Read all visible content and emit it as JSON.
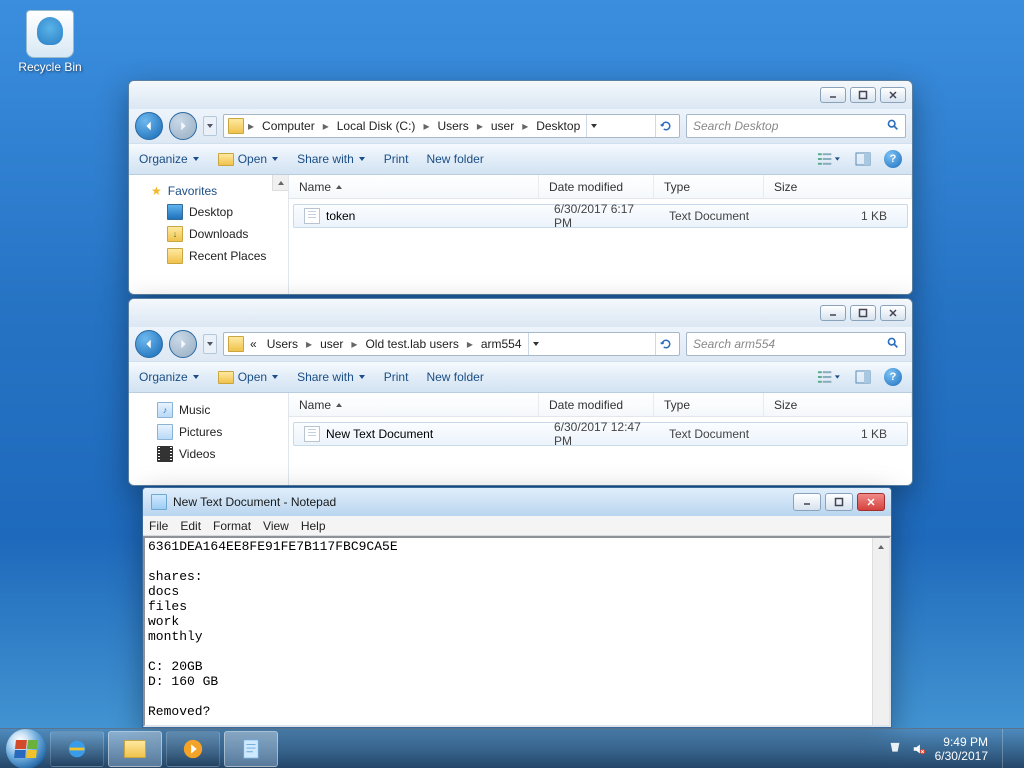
{
  "desktop": {
    "recycle_bin": "Recycle Bin"
  },
  "explorer1": {
    "crumbs": [
      "Computer",
      "Local Disk (C:)",
      "Users",
      "user",
      "Desktop"
    ],
    "search_placeholder": "Search Desktop",
    "toolbar": {
      "organize": "Organize",
      "open": "Open",
      "share": "Share with",
      "print": "Print",
      "newfolder": "New folder"
    },
    "cols": {
      "name": "Name",
      "date": "Date modified",
      "type": "Type",
      "size": "Size"
    },
    "sidebar": {
      "favorites": "Favorites",
      "items": [
        "Desktop",
        "Downloads",
        "Recent Places"
      ]
    },
    "rows": [
      {
        "name": "token",
        "date": "6/30/2017 6:17 PM",
        "type": "Text Document",
        "size": "1 KB"
      }
    ]
  },
  "explorer2": {
    "crumbs_prefix": "«",
    "crumbs": [
      "Users",
      "user",
      "Old test.lab users",
      "arm554"
    ],
    "search_placeholder": "Search arm554",
    "toolbar": {
      "organize": "Organize",
      "open": "Open",
      "share": "Share with",
      "print": "Print",
      "newfolder": "New folder"
    },
    "cols": {
      "name": "Name",
      "date": "Date modified",
      "type": "Type",
      "size": "Size"
    },
    "sidebar": {
      "items": [
        "Music",
        "Pictures",
        "Videos"
      ]
    },
    "rows": [
      {
        "name": "New Text Document",
        "date": "6/30/2017 12:47 PM",
        "type": "Text Document",
        "size": "1 KB"
      }
    ]
  },
  "notepad": {
    "title": "New Text Document - Notepad",
    "menu": [
      "File",
      "Edit",
      "Format",
      "View",
      "Help"
    ],
    "content": "6361DEA164EE8FE91FE7B117FBC9CA5E\n\nshares:\ndocs\nfiles\nwork\nmonthly\n\nC: 20GB\nD: 160 GB\n\nRemoved?"
  },
  "tray": {
    "time": "9:49 PM",
    "date": "6/30/2017"
  }
}
